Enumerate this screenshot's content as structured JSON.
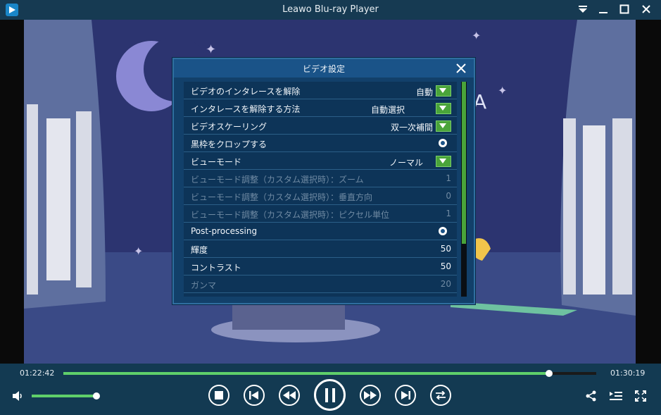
{
  "window": {
    "title": "Leawo Blu-ray Player"
  },
  "dialog": {
    "title": "ビデオ設定",
    "rows": [
      {
        "label": "ビデオのインタレースを解除",
        "control": "dropdown",
        "value": "自動",
        "enabled": true
      },
      {
        "label": "インタレースを解除する方法",
        "control": "dropdown",
        "value": "自動選択",
        "enabled": true
      },
      {
        "label": "ビデオスケーリング",
        "control": "dropdown",
        "value": "双一次補間",
        "enabled": true
      },
      {
        "label": "黒枠をクロップする",
        "control": "toggle",
        "value": "",
        "enabled": true
      },
      {
        "label": "ビューモード",
        "control": "dropdown",
        "value": "ノーマル",
        "enabled": true
      },
      {
        "label": "ビューモード調整（カスタム選択時）：ズーム",
        "control": "number",
        "value": "1",
        "enabled": false
      },
      {
        "label": "ビューモード調整（カスタム選択時）：垂直方向",
        "control": "number",
        "value": "0",
        "enabled": false
      },
      {
        "label": "ビューモード調整（カスタム選択時）：ピクセル単位",
        "control": "number",
        "value": "1",
        "enabled": false
      },
      {
        "label": "Post-processing",
        "control": "toggle",
        "value": "",
        "enabled": true
      },
      {
        "label": "輝度",
        "control": "number",
        "value": "50",
        "enabled": true
      },
      {
        "label": "コントラスト",
        "control": "number",
        "value": "50",
        "enabled": true
      },
      {
        "label": "ガンマ",
        "control": "number",
        "value": "20",
        "enabled": false
      }
    ]
  },
  "player": {
    "current_time": "01:22:42",
    "total_time": "01:30:19",
    "progress": 0.911,
    "volume": 0.97
  },
  "colors": {
    "accent": "#5fcf6a",
    "dialog_bg": "#12406a",
    "dropdown_green": "#4aa43a"
  },
  "icons": [
    "speaker-icon",
    "stop-icon",
    "previous-icon",
    "rewind-icon",
    "pause-icon",
    "fast-forward-icon",
    "next-icon",
    "repeat-icon",
    "share-icon",
    "playlist-icon",
    "fullscreen-icon"
  ]
}
